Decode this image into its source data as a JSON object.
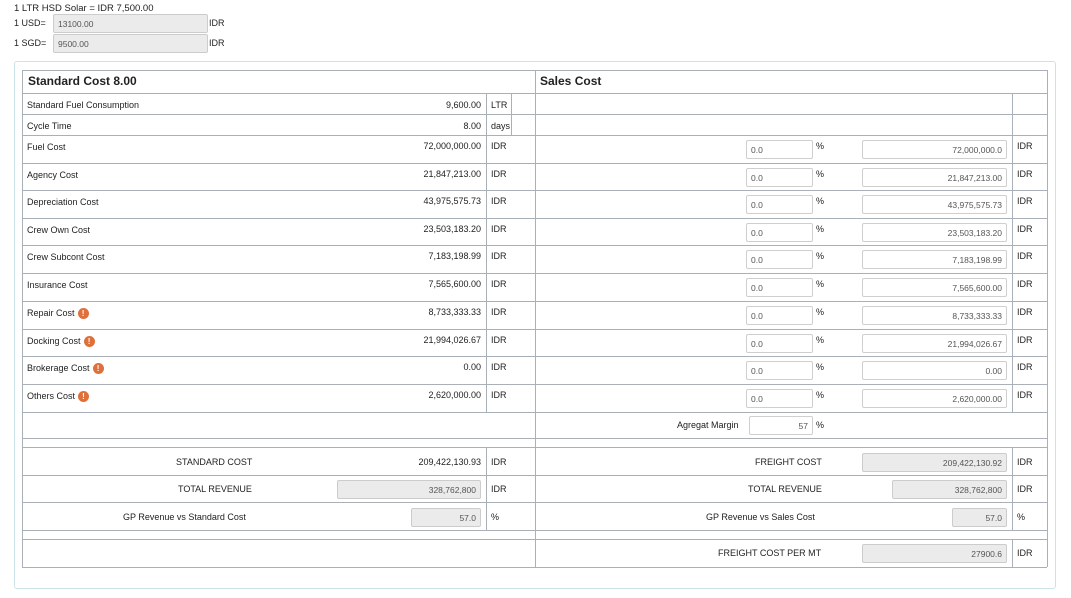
{
  "exchange": {
    "hsd_rate": "1 LTR HSD Solar = IDR 7,500.00",
    "usd_label": "1 USD=",
    "usd_value": "13100.00",
    "sgd_label": "1 SGD=",
    "sgd_value": "9500.00",
    "currency": "IDR"
  },
  "standard": {
    "title": "Standard Cost 8.00",
    "fuel_consumption": {
      "label": "Standard Fuel Consumption",
      "value": "9,600.00",
      "unit": "LTR"
    },
    "cycle_time": {
      "label": "Cycle Time",
      "value": "8.00",
      "unit": "days"
    }
  },
  "sales": {
    "title": "Sales Cost"
  },
  "cost_rows": [
    {
      "label": "Fuel Cost",
      "value": "72,000,000.00",
      "unit": "IDR",
      "pct": "0.0",
      "pct_sym": "%",
      "sales": "72,000,000.0",
      "sales_unit": "IDR",
      "warn": false
    },
    {
      "label": "Agency Cost",
      "value": "21,847,213.00",
      "unit": "IDR",
      "pct": "0.0",
      "pct_sym": "%",
      "sales": "21,847,213.00",
      "sales_unit": "IDR",
      "warn": false
    },
    {
      "label": "Depreciation Cost",
      "value": "43,975,575.73",
      "unit": "IDR",
      "pct": "0.0",
      "pct_sym": "%",
      "sales": "43,975,575.73",
      "sales_unit": "IDR",
      "warn": false
    },
    {
      "label": "Crew Own Cost",
      "value": "23,503,183.20",
      "unit": "IDR",
      "pct": "0.0",
      "pct_sym": "%",
      "sales": "23,503,183.20",
      "sales_unit": "IDR",
      "warn": false
    },
    {
      "label": "Crew Subcont Cost",
      "value": "7,183,198.99",
      "unit": "IDR",
      "pct": "0.0",
      "pct_sym": "%",
      "sales": "7,183,198.99",
      "sales_unit": "IDR",
      "warn": false
    },
    {
      "label": "Insurance Cost",
      "value": "7,565,600.00",
      "unit": "IDR",
      "pct": "0.0",
      "pct_sym": "%",
      "sales": "7,565,600.00",
      "sales_unit": "IDR",
      "warn": false
    },
    {
      "label": "Repair Cost",
      "value": "8,733,333.33",
      "unit": "IDR",
      "pct": "0.0",
      "pct_sym": "%",
      "sales": "8,733,333.33",
      "sales_unit": "IDR",
      "warn": true
    },
    {
      "label": "Docking Cost",
      "value": "21,994,026.67",
      "unit": "IDR",
      "pct": "0.0",
      "pct_sym": "%",
      "sales": "21,994,026.67",
      "sales_unit": "IDR",
      "warn": true
    },
    {
      "label": "Brokerage Cost",
      "value": "0.00",
      "unit": "IDR",
      "pct": "0.0",
      "pct_sym": "%",
      "sales": "0.00",
      "sales_unit": "IDR",
      "warn": true
    },
    {
      "label": "Others Cost",
      "value": "2,620,000.00",
      "unit": "IDR",
      "pct": "0.0",
      "pct_sym": "%",
      "sales": "2,620,000.00",
      "sales_unit": "IDR",
      "warn": true
    }
  ],
  "warn_glyph": "!",
  "agregat": {
    "label": "Agregat Margin",
    "value": "57",
    "unit": "%"
  },
  "summary_left": {
    "standard_cost": {
      "label": "STANDARD COST",
      "value": "209,422,130.93",
      "unit": "IDR"
    },
    "total_revenue": {
      "label": "TOTAL REVENUE",
      "value": "328,762,800",
      "unit": "IDR"
    },
    "gp": {
      "label": "GP Revenue vs Standard Cost",
      "value": "57.0",
      "unit": "%"
    }
  },
  "summary_right": {
    "freight_cost": {
      "label": "FREIGHT COST",
      "value": "209,422,130.92",
      "unit": "IDR"
    },
    "total_revenue": {
      "label": "TOTAL REVENUE",
      "value": "328,762,800",
      "unit": "IDR"
    },
    "gp": {
      "label": "GP Revenue vs Sales Cost",
      "value": "57.0",
      "unit": "%"
    },
    "freight_per_mt": {
      "label": "FREIGHT COST PER MT",
      "value": "27900.6",
      "unit": "IDR"
    }
  },
  "colors": {
    "warn": "#e0703a",
    "border": "#a9b0b7",
    "panel_border": "#cde3ea",
    "readonly_bg": "#ebebeb"
  }
}
